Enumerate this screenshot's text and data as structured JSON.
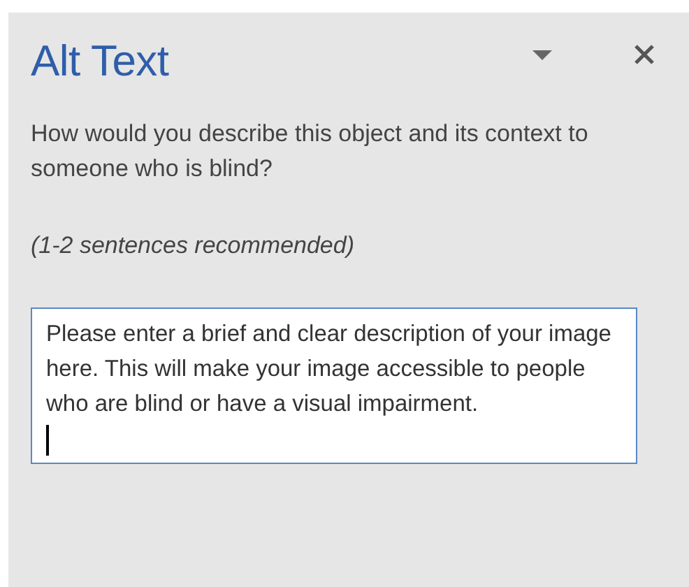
{
  "pane": {
    "title": "Alt Text",
    "question": "How would you describe this object and its context to someone who is blind?",
    "hint": "(1-2 sentences recommended)"
  },
  "description": {
    "value": "Please enter a brief and clear description of your image here. This will make your image accessible to people who are blind or have a visual impairment."
  }
}
